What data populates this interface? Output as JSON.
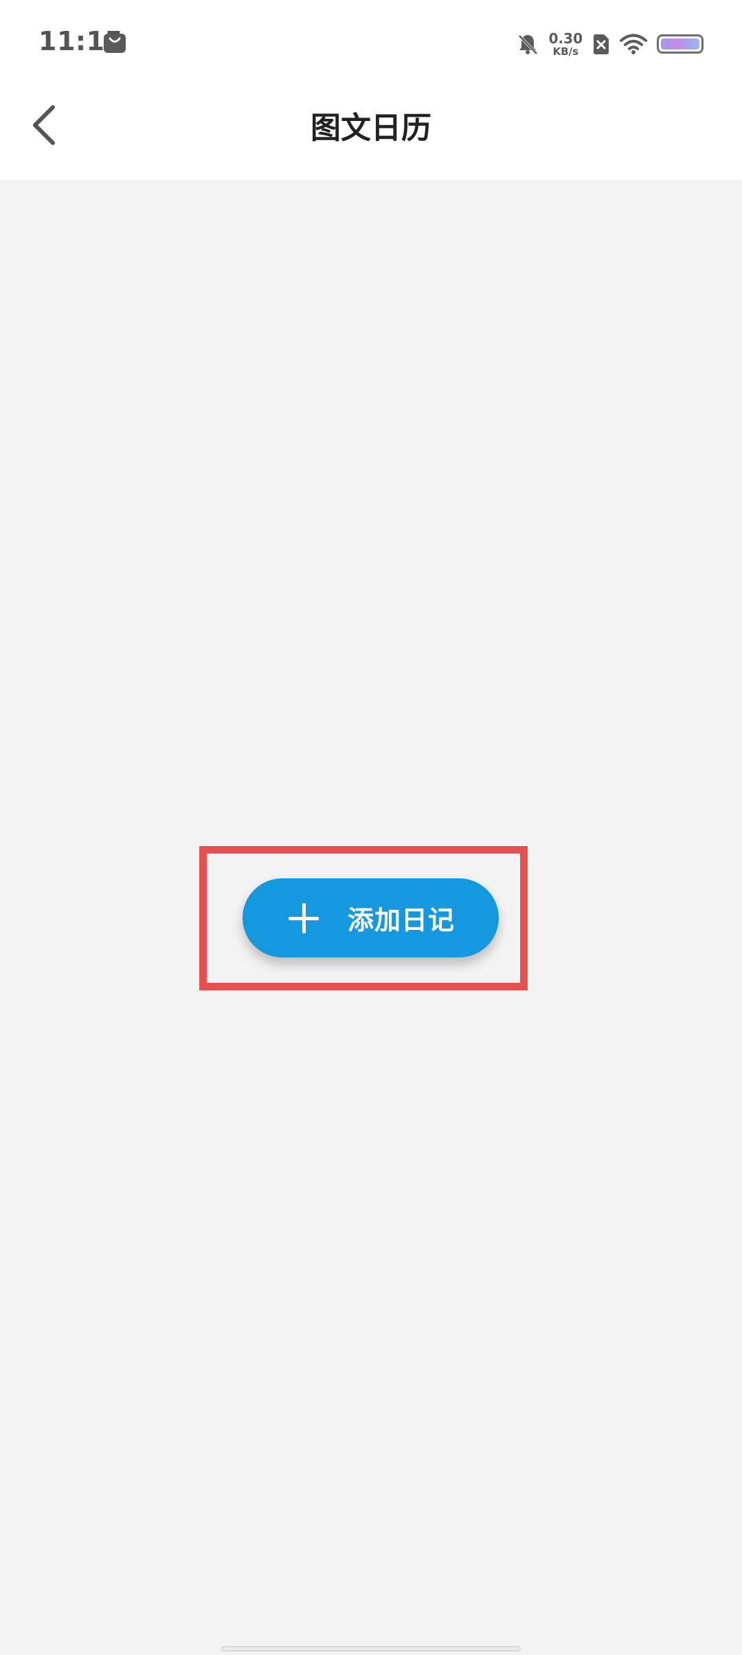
{
  "status_bar": {
    "time": "11:15",
    "net_speed_value": "0.30",
    "net_speed_unit": "KB/s",
    "icons": [
      "shopping-bag-icon",
      "bell-muted-icon",
      "sim-none-icon",
      "wifi-icon",
      "battery-icon"
    ],
    "battery_level": 1.0
  },
  "header": {
    "title": "图文日历",
    "back_icon": "chevron-left-icon"
  },
  "main": {
    "add_button_label": "添加日记",
    "add_icon": "plus-icon"
  },
  "colors": {
    "accent": "#1598dd",
    "highlight": "#e65150",
    "background": "#f3f3f3"
  }
}
